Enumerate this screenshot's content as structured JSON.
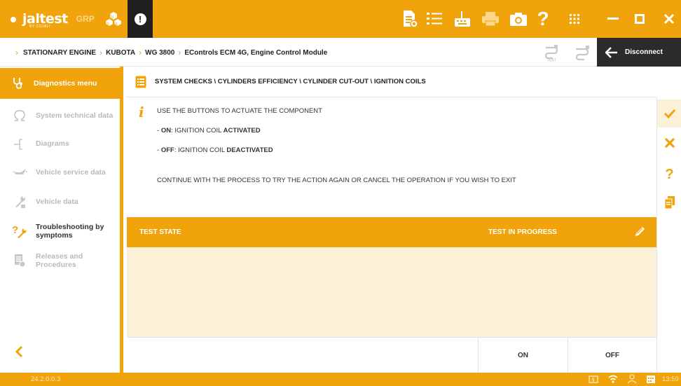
{
  "app": {
    "brand": "jaltest",
    "brand_sub": "BY COJALI",
    "product": "GRP",
    "accent": "#f0a30a"
  },
  "toolbar": {
    "icons": [
      "report-icon",
      "list-icon",
      "keyboard-icon",
      "printer-icon",
      "camera-icon",
      "help-icon",
      "apps-grid-icon"
    ],
    "alert_icon": "alert-icon",
    "window_controls": [
      "minimize-icon",
      "maximize-icon",
      "close-icon"
    ]
  },
  "breadcrumb": {
    "items": [
      "STATIONARY ENGINE",
      "KUBOTA",
      "WG 3800",
      "EControls ECM 4G, Engine Control Module"
    ],
    "disconnect_label": "Disconnect"
  },
  "sidebar": {
    "header": "Diagnostics menu",
    "items": [
      {
        "label": "System technical data",
        "icon": "omega-icon",
        "active": false
      },
      {
        "label": "Diagrams",
        "icon": "diagram-icon",
        "active": false
      },
      {
        "label": "Vehicle service data",
        "icon": "oil-can-icon",
        "active": false
      },
      {
        "label": "Vehicle data",
        "icon": "wrench-icon",
        "active": false
      },
      {
        "label": "Troubleshooting by symptoms",
        "icon": "troubleshoot-icon",
        "active": true
      },
      {
        "label": "Releases and Procedures",
        "icon": "document-icon",
        "active": false
      }
    ]
  },
  "main": {
    "path": "SYSTEM CHECKS \\ CYLINDERS EFFICIENCY \\ CYLINDER CUT-OUT \\ IGNITION COILS",
    "instruction_1": "USE THE BUTTONS TO ACTUATE THE COMPONENT",
    "on_line": {
      "prefix": "- ",
      "key": "ON",
      "text": ": IGNITION COIL ",
      "state": "ACTIVATED"
    },
    "off_line": {
      "prefix": "- ",
      "key": "OFF",
      "text": ": IGNITION COIL ",
      "state": "DEACTIVATED"
    },
    "instruction_2": "CONTINUE WITH THE PROCESS TO TRY THE ACTION AGAIN OR CANCEL THE OPERATION IF YOU WISH TO EXIT",
    "test_state_label": "TEST STATE",
    "test_status": "TEST IN PROGRESS",
    "on_button": "ON",
    "off_button": "OFF"
  },
  "footer": {
    "version": "24.2.0.0.3",
    "time": "13:59"
  }
}
